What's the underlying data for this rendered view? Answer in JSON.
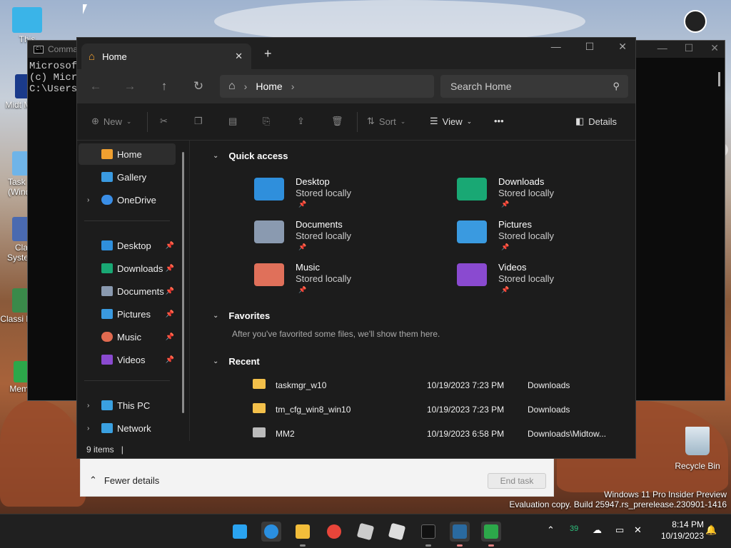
{
  "desktop": {
    "icons": [
      {
        "label": "This"
      },
      {
        "label": "Midt Madr"
      },
      {
        "label": "Task M (Windo"
      },
      {
        "label": "Cla System"
      },
      {
        "label": "Classi Man"
      },
      {
        "label": "Mem I"
      }
    ],
    "recycle_bin": "Recycle Bin",
    "watermark_line1": "Windows 11 Pro Insider Preview",
    "watermark_line2": "Evaluation copy. Build 25947.rs_prerelease.230901-1416"
  },
  "console": {
    "title": "Comma",
    "lines": [
      "Microsoft",
      "(c) Micro",
      "",
      "C:\\Users\\"
    ]
  },
  "taskmgr": {
    "fewer_details": "Fewer details",
    "end_task": "End task"
  },
  "explorer": {
    "tab_title": "Home",
    "address": {
      "home_label": "Home"
    },
    "search_placeholder": "Search Home",
    "toolbar": {
      "new_label": "New",
      "sort_label": "Sort",
      "view_label": "View",
      "more_label": "•••",
      "details_label": "Details"
    },
    "sidebar": {
      "top": [
        {
          "label": "Home",
          "icon": "home-icon",
          "color": "#f0a030"
        },
        {
          "label": "Gallery",
          "icon": "gallery-icon",
          "color": "#3a9ae0"
        },
        {
          "label": "OneDrive",
          "icon": "cloud-icon",
          "color": "#3a8ee6"
        }
      ],
      "pinned": [
        {
          "label": "Desktop",
          "icon": "desktop-folder-icon",
          "color": "#2f8fdc"
        },
        {
          "label": "Downloads",
          "icon": "download-folder-icon",
          "color": "#19a874"
        },
        {
          "label": "Documents",
          "icon": "documents-folder-icon",
          "color": "#8a9ab0"
        },
        {
          "label": "Pictures",
          "icon": "pictures-folder-icon",
          "color": "#3a9ae0"
        },
        {
          "label": "Music",
          "icon": "music-folder-icon",
          "color": "#e06a50"
        },
        {
          "label": "Videos",
          "icon": "videos-folder-icon",
          "color": "#8a4ad0"
        }
      ],
      "bottom": [
        {
          "label": "This PC",
          "icon": "pc-icon",
          "color": "#3aa0e0"
        },
        {
          "label": "Network",
          "icon": "network-icon",
          "color": "#3aa0e0"
        }
      ]
    },
    "quick_access": {
      "title": "Quick access",
      "items": [
        {
          "name": "Desktop",
          "sub": "Stored locally",
          "icon": "desktop-folder-icon",
          "color": "#2f8fdc"
        },
        {
          "name": "Downloads",
          "sub": "Stored locally",
          "icon": "download-folder-icon",
          "color": "#19a874"
        },
        {
          "name": "Documents",
          "sub": "Stored locally",
          "icon": "documents-folder-icon",
          "color": "#8a9ab0"
        },
        {
          "name": "Pictures",
          "sub": "Stored locally",
          "icon": "pictures-folder-icon",
          "color": "#3a9ae0"
        },
        {
          "name": "Music",
          "sub": "Stored locally",
          "icon": "music-folder-icon",
          "color": "#e0705a"
        },
        {
          "name": "Videos",
          "sub": "Stored locally",
          "icon": "videos-folder-icon",
          "color": "#8a4ad0"
        }
      ]
    },
    "favorites": {
      "title": "Favorites",
      "note": "After you've favorited some files, we'll show them here."
    },
    "recent": {
      "title": "Recent",
      "rows": [
        {
          "name": "taskmgr_w10",
          "date": "10/19/2023 7:23 PM",
          "location": "Downloads"
        },
        {
          "name": "tm_cfg_win8_win10",
          "date": "10/19/2023 7:23 PM",
          "location": "Downloads"
        },
        {
          "name": "MM2",
          "date": "10/19/2023 6:58 PM",
          "location": "Downloads\\Midtow..."
        }
      ]
    },
    "status": {
      "items": "9 items",
      "sep": "|"
    }
  },
  "taskbar": {
    "tray_badge": "39",
    "time": "8:14 PM",
    "date": "10/19/2023"
  }
}
